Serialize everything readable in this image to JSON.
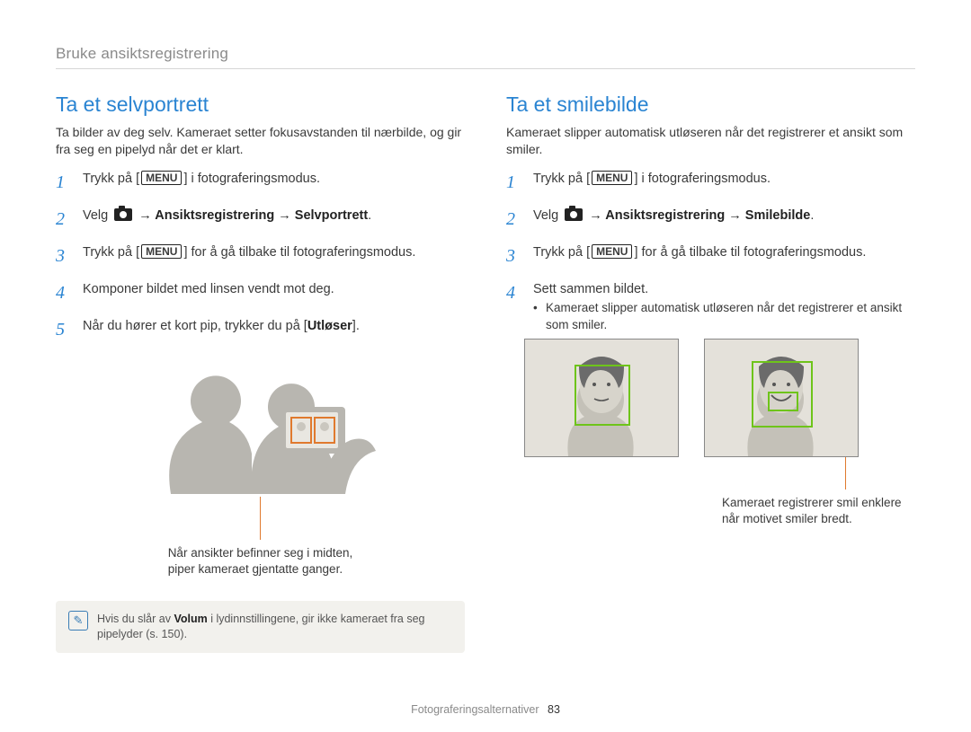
{
  "breadcrumb": "Bruke ansiktsregistrering",
  "left": {
    "title": "Ta et selvportrett",
    "intro": "Ta bilder av deg selv. Kameraet setter fokusavstanden til nærbilde, og gir fra seg en pipelyd når det er klart.",
    "step1_a": "Trykk på [",
    "menu": "MENU",
    "step1_b": "] i fotograferingsmodus.",
    "step2_a": "Velg ",
    "step2_b": " → Ansiktsregistrering → Selvportrett",
    "step3_a": "Trykk på [",
    "step3_b": "] for å gå tilbake til fotograferingsmodus.",
    "step4": "Komponer bildet med linsen vendt mot deg.",
    "step5_a": "Når du hører et kort pip, trykker du på [",
    "step5_b": "Utløser",
    "step5_c": "].",
    "callout_l1": "Når ansikter befinner seg i midten,",
    "callout_l2": "piper kameraet gjentatte ganger.",
    "note_a": "Hvis du slår av ",
    "note_b": "Volum",
    "note_c": " i lydinnstillingene, gir ikke kameraet fra seg pipelyder (s. 150)."
  },
  "right": {
    "title": "Ta et smilebilde",
    "intro": "Kameraet slipper automatisk utløseren når det registrerer et ansikt som smiler.",
    "step1_a": "Trykk på [",
    "step1_b": "] i fotograferingsmodus.",
    "step2_a": "Velg ",
    "step2_b": " → Ansiktsregistrering → Smilebilde",
    "step3_a": "Trykk på [",
    "step3_b": "] for å gå tilbake til fotograferingsmodus.",
    "step4": "Sett sammen bildet.",
    "bullet": "Kameraet slipper automatisk utløseren når det registrerer et ansikt som smiler.",
    "callout_l1": "Kameraet registrerer smil enklere",
    "callout_l2": "når motivet smiler bredt."
  },
  "footer_label": "Fotograferingsalternativer",
  "page_num": "83"
}
